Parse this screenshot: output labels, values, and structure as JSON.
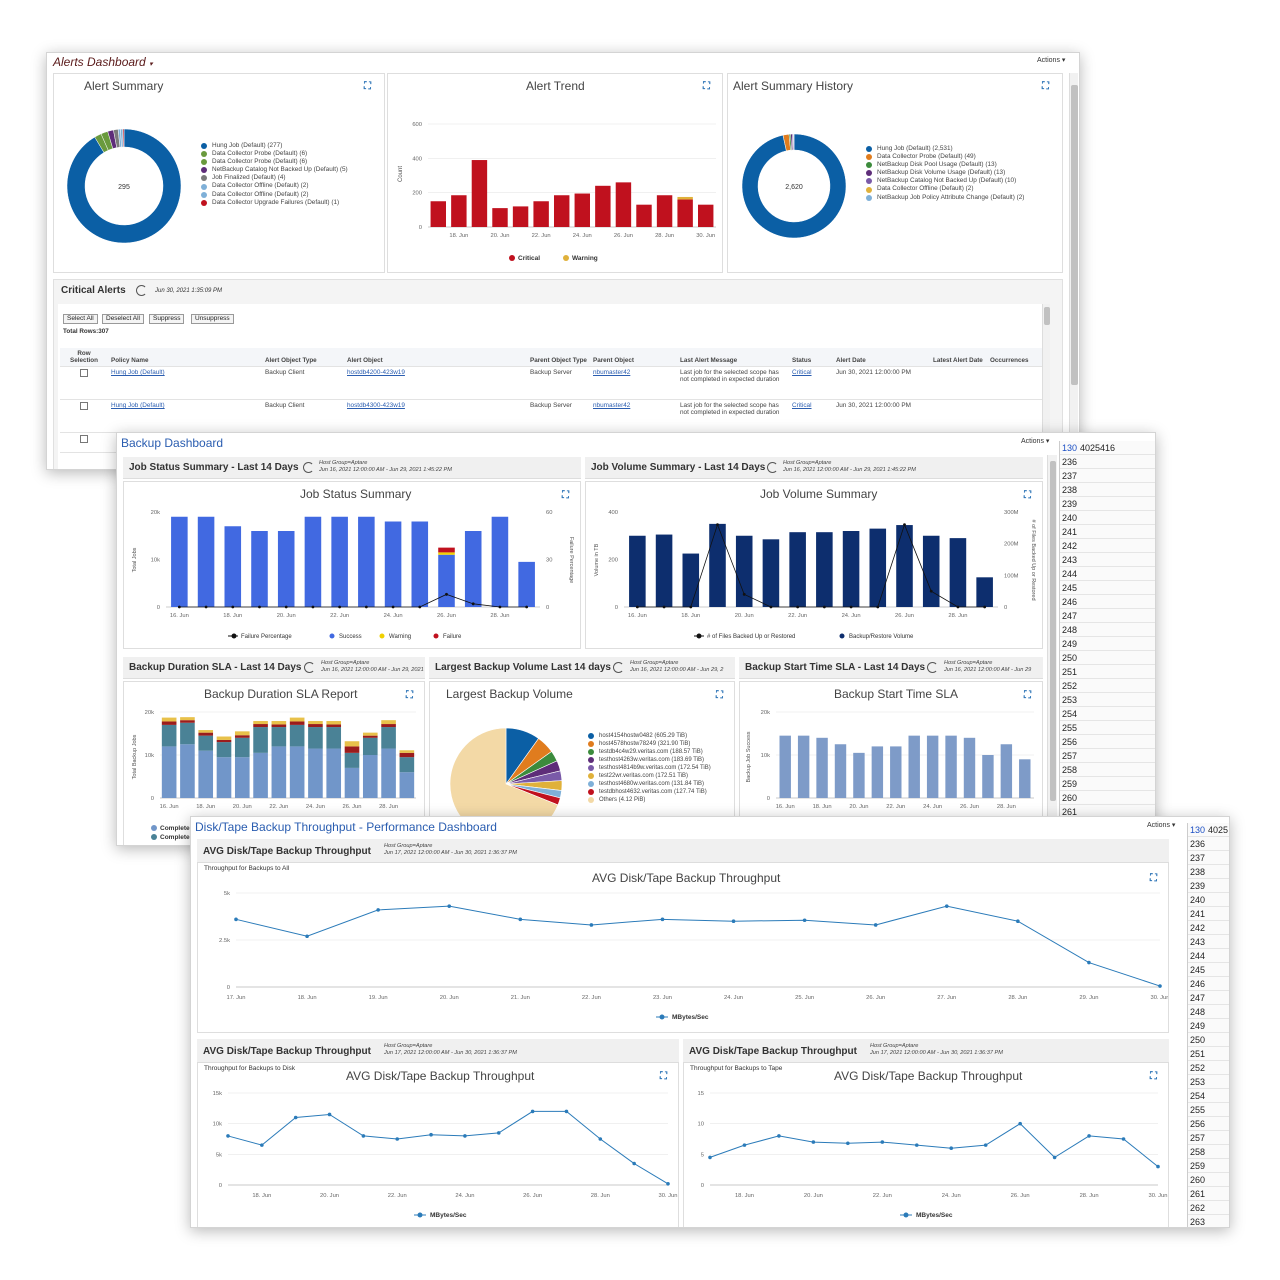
{
  "alerts": {
    "title": "Alerts Dashboard",
    "actions": "Actions",
    "summary": {
      "title": "Alert Summary",
      "center": "295",
      "legend": [
        {
          "label": "Hung Job (Default) (277)",
          "color": "#0b5fa5"
        },
        {
          "label": "Data Collector Probe (Default) (6)",
          "color": "#6a9a3d"
        },
        {
          "label": "Data Collector Probe (Default) (6)",
          "color": "#6a9a3d"
        },
        {
          "label": "NetBackup Catalog Not Backed Up (Default) (5)",
          "color": "#5e2d79"
        },
        {
          "label": "Job Finalized (Default) (4)",
          "color": "#7a7a7a"
        },
        {
          "label": "Data Collector Offline (Default) (2)",
          "color": "#7fb0d8"
        },
        {
          "label": "Data Collector Offline (Default) (2)",
          "color": "#7fb0d8"
        },
        {
          "label": "Data Collector Upgrade Failures (Default) (1)",
          "color": "#c0111e"
        }
      ]
    },
    "trend": {
      "title": "Alert Trend",
      "ylabel": "Count",
      "yticks": [
        "600",
        "400",
        "200",
        "0"
      ],
      "xticks": [
        "18. Jun",
        "20. Jun",
        "22. Jun",
        "24. Jun",
        "26. Jun",
        "28. Jun",
        "30. Jun"
      ],
      "legend": [
        {
          "label": "Critical",
          "color": "#c0111e"
        },
        {
          "label": "Warning",
          "color": "#e0b13a"
        }
      ]
    },
    "history": {
      "title": "Alert Summary History",
      "center": "2,620",
      "legend": [
        {
          "label": "Hung Job (Default) (2,531)",
          "color": "#0b5fa5"
        },
        {
          "label": "Data Collector Probe (Default) (49)",
          "color": "#e07c1e"
        },
        {
          "label": "NetBackup Disk Pool Usage (Default) (13)",
          "color": "#3c8b3c"
        },
        {
          "label": "NetBackup Disk Volume Usage (Default) (13)",
          "color": "#5e2d79"
        },
        {
          "label": "NetBackup Catalog Not Backed Up (Default) (10)",
          "color": "#7a5aa8"
        },
        {
          "label": "Data Collector Offline (Default) (2)",
          "color": "#e0b13a"
        },
        {
          "label": "NetBackup Job Policy Attribute Change (Default) (2)",
          "color": "#7fb0d8"
        }
      ]
    },
    "critical": {
      "title": "Critical Alerts",
      "timestamp": "Jun 30, 2021 1:35:09 PM",
      "buttons": [
        "Select All",
        "Deselect All",
        "Suppress",
        "Unsuppress"
      ],
      "total": "Total Rows:307",
      "columns": [
        "Row Selection",
        "Policy Name",
        "Alert Object Type",
        "Alert Object",
        "Parent Object Type",
        "Parent Object",
        "Last Alert Message",
        "Status",
        "Alert Date",
        "Latest Alert Date",
        "Occurrences"
      ],
      "rows": [
        {
          "policy": "Hung Job (Default)",
          "type": "Backup Client",
          "object": "hostdb4200-423w19",
          "ptype": "Backup Server",
          "parent": "nbumaster42",
          "msg": "Last job for the selected scope has not completed in expected duration",
          "status": "Critical",
          "date": "Jun 30, 2021 12:00:00 PM"
        },
        {
          "policy": "Hung Job (Default)",
          "type": "Backup Client",
          "object": "hostdb4300-423w19",
          "ptype": "Backup Server",
          "parent": "nbumaster42",
          "msg": "Last job for the selected scope has not completed in expected duration",
          "status": "Critical",
          "date": "Jun 30, 2021 12:00:00 PM"
        }
      ]
    }
  },
  "backup": {
    "title": "Backup Dashboard",
    "actions": "Actions",
    "jobstatus": {
      "header": "Job Status Summary - Last 14 Days",
      "meta1": "Host Group=Aptare",
      "meta2": "Jun 16, 2021 12:00:00 AM - Jun 29, 2021 1:45:22 PM",
      "title": "Job Status Summary",
      "ylabel": "Total Jobs",
      "y2label": "Failure Percentage",
      "yticks": [
        "20k",
        "10k",
        "0"
      ],
      "y2ticks": [
        "60",
        "30",
        "0"
      ],
      "xticks": [
        "16. Jun",
        "18. Jun",
        "20. Jun",
        "22. Jun",
        "24. Jun",
        "26. Jun",
        "28. Jun"
      ],
      "legend": [
        {
          "label": "Failure Percentage",
          "color": "#111"
        },
        {
          "label": "Success",
          "color": "#4169e1"
        },
        {
          "label": "Warning",
          "color": "#f0d000"
        },
        {
          "label": "Failure",
          "color": "#c0111e"
        }
      ]
    },
    "jobvolume": {
      "header": "Job Volume Summary - Last 14 Days",
      "meta1": "Host Group=Aptare",
      "meta2": "Jun 16, 2021 12:00:00 AM - Jun 29, 2021 1:45:22 PM",
      "title": "Job Volume Summary",
      "ylabel": "Volume in TB",
      "y2label": "# of Files Backed Up or Restored",
      "yticks": [
        "400",
        "200",
        "0"
      ],
      "y2ticks": [
        "300M",
        "200M",
        "100M",
        "0"
      ],
      "xticks": [
        "16. Jun",
        "18. Jun",
        "20. Jun",
        "22. Jun",
        "24. Jun",
        "26. Jun",
        "28. Jun"
      ],
      "legend": [
        {
          "label": "# of Files Backed Up or Restored",
          "color": "#111"
        },
        {
          "label": "Backup/Restore Volume",
          "color": "#0d2e6e"
        }
      ]
    },
    "duration": {
      "header": "Backup Duration SLA - Last 14 Days",
      "meta1": "Host Group=Aptare",
      "meta2": "Jun 16, 2021 12:00:00 AM - Jun 29, 2021",
      "title": "Backup Duration SLA Report",
      "ylabel": "Total Backup Jobs",
      "yticks": [
        "20k",
        "10k",
        "0"
      ],
      "xticks": [
        "16. Jun",
        "18. Jun",
        "20. Jun",
        "22. Jun",
        "24. Jun",
        "26. Jun",
        "28. Jun"
      ],
      "legend": [
        "Complete",
        "Complete"
      ]
    },
    "largest": {
      "header": "Largest Backup Volume Last 14 days",
      "meta1": "Host Group=Aptare",
      "meta2": "Jun 16, 2021 12:00:00 AM - Jun 29, 2",
      "title": "Largest Backup Volume",
      "legend": [
        {
          "label": "host4154hostw0482 (605.29 TiB)",
          "color": "#0b5fa5"
        },
        {
          "label": "host4578hostw78249 (321.90 TiB)",
          "color": "#e07c1e"
        },
        {
          "label": "testdb4c4w29.veritas.com (188.57 TiB)",
          "color": "#3c8b3c"
        },
        {
          "label": "testhost4263w.veritas.com (183.69 TiB)",
          "color": "#5e2d79"
        },
        {
          "label": "testhost4814b9w.veritas.com (172.54 TiB)",
          "color": "#7a5aa8"
        },
        {
          "label": "test22wr.veritas.com (172.51 TiB)",
          "color": "#e0b13a"
        },
        {
          "label": "testhost4680w.veritas.com (131.84 TiB)",
          "color": "#7fb0d8"
        },
        {
          "label": "testdbhost4632.veritas.com (127.74 TiB)",
          "color": "#c0111e"
        },
        {
          "label": "Others (4.12 PiB)",
          "color": "#f3d9a6"
        }
      ]
    },
    "starttime": {
      "header": "Backup Start Time SLA - Last 14 Days",
      "meta1": "Host Group=Aptare",
      "meta2": "Jun 16, 2021 12:00:00 AM - Jun 29",
      "title": "Backup Start Time SLA",
      "ylabel": "Backup Job Success",
      "yticks": [
        "20k",
        "10k",
        "0"
      ],
      "xticks": [
        "16. Jun",
        "18. Jun",
        "20. Jun",
        "22. Jun",
        "24. Jun",
        "26. Jun",
        "28. Jun"
      ]
    }
  },
  "perf": {
    "title": "Disk/Tape Backup Throughput - Performance Dashboard",
    "actions": "Actions",
    "main": {
      "header": "AVG Disk/Tape Backup Throughput",
      "meta1": "Host Group=Aptare",
      "meta2": "Jun 17, 2021 12:00:00 AM - Jun 30, 2021 1:36:37 PM",
      "subtitle": "Throughput for Backups to All",
      "title": "AVG Disk/Tape Backup Throughput",
      "yticks": [
        "5k",
        "2.5k",
        "0"
      ],
      "xticks": [
        "17. Jun",
        "18. Jun",
        "19. Jun",
        "20. Jun",
        "21. Jun",
        "22. Jun",
        "23. Jun",
        "24. Jun",
        "25. Jun",
        "26. Jun",
        "27. Jun",
        "28. Jun",
        "29. Jun",
        "30. Jun"
      ],
      "legend": "MBytes/Sec"
    },
    "disk": {
      "header": "AVG Disk/Tape Backup Throughput",
      "meta1": "Host Group=Aptare",
      "meta2": "Jun 17, 2021 12:00:00 AM - Jun 30, 2021 1:36:37 PM",
      "subtitle": "Throughput for Backups to Disk",
      "title": "AVG Disk/Tape Backup Throughput",
      "yticks": [
        "15k",
        "10k",
        "5k",
        "0"
      ],
      "xticks": [
        "18. Jun",
        "20. Jun",
        "22. Jun",
        "24. Jun",
        "26. Jun",
        "28. Jun",
        "30. Jun"
      ],
      "legend": "MBytes/Sec"
    },
    "tape": {
      "header": "AVG Disk/Tape Backup Throughput",
      "meta1": "Host Group=Aptare",
      "meta2": "Jun 17, 2021 12:00:00 AM - Jun 30, 2021 1:36:37 PM",
      "subtitle": "Throughput for Backups to Tape",
      "title": "AVG Disk/Tape Backup Throughput",
      "yticks": [
        "15",
        "10",
        "5",
        "0"
      ],
      "xticks": [
        "18. Jun",
        "20. Jun",
        "22. Jun",
        "24. Jun",
        "26. Jun",
        "28. Jun",
        "30. Jun"
      ],
      "legend": "MBytes/Sec"
    }
  },
  "sheet": {
    "cell_ref1": "130",
    "cell_val1": "4025416",
    "cell_ref2": "130",
    "cell_val2": "4025",
    "rows": [
      "236",
      "237",
      "238",
      "239",
      "240",
      "241",
      "242",
      "243",
      "244",
      "245",
      "246",
      "247",
      "248",
      "249",
      "250",
      "251",
      "252",
      "253",
      "254",
      "255",
      "256",
      "257",
      "258",
      "259",
      "260",
      "261",
      "262",
      "263"
    ]
  },
  "chart_data": [
    {
      "type": "pie",
      "title": "Alert Summary",
      "center_label": "295",
      "labels": [
        "Hung Job (Default)",
        "Data Collector Probe (Default)",
        "Data Collector Probe (Default)",
        "NetBackup Catalog Not Backed Up (Default)",
        "Job Finalized (Default)",
        "Data Collector Offline (Default)",
        "Data Collector Offline (Default)",
        "Data Collector Upgrade Failures (Default)"
      ],
      "values": [
        277,
        6,
        6,
        5,
        4,
        2,
        2,
        1
      ]
    },
    {
      "type": "bar",
      "title": "Alert Trend",
      "ylabel": "Count",
      "ylim": [
        0,
        600
      ],
      "categories": [
        "17",
        "18",
        "19",
        "20",
        "21",
        "22",
        "23",
        "24",
        "25",
        "26",
        "27",
        "28",
        "29",
        "30"
      ],
      "series": [
        {
          "name": "Critical",
          "values": [
            150,
            185,
            390,
            110,
            120,
            150,
            185,
            195,
            240,
            260,
            130,
            185,
            160,
            130
          ]
        },
        {
          "name": "Warning",
          "values": [
            0,
            0,
            0,
            0,
            0,
            0,
            0,
            0,
            0,
            0,
            0,
            0,
            15,
            0
          ]
        }
      ]
    },
    {
      "type": "pie",
      "title": "Alert Summary History",
      "center_label": "2,620",
      "labels": [
        "Hung Job (Default)",
        "Data Collector Probe (Default)",
        "NetBackup Disk Pool Usage (Default)",
        "NetBackup Disk Volume Usage (Default)",
        "NetBackup Catalog Not Backed Up (Default)",
        "Data Collector Offline (Default)",
        "NetBackup Job Policy Attribute Change (Default)"
      ],
      "values": [
        2531,
        49,
        13,
        13,
        10,
        2,
        2
      ]
    },
    {
      "type": "bar",
      "title": "Job Status Summary",
      "ylim": [
        0,
        20000
      ],
      "categories": [
        "16",
        "17",
        "18",
        "19",
        "20",
        "21",
        "22",
        "23",
        "24",
        "25",
        "26",
        "27",
        "28",
        "29"
      ],
      "series": [
        {
          "name": "Success",
          "values": [
            19000,
            19000,
            17000,
            16000,
            16000,
            19000,
            19000,
            19000,
            18000,
            18000,
            11000,
            16000,
            19000,
            9500
          ]
        },
        {
          "name": "Warning",
          "values": [
            0,
            0,
            0,
            0,
            0,
            0,
            0,
            0,
            0,
            0,
            500,
            0,
            0,
            0
          ]
        },
        {
          "name": "Failure",
          "values": [
            0,
            0,
            0,
            0,
            0,
            0,
            0,
            0,
            0,
            0,
            1000,
            0,
            0,
            0
          ]
        },
        {
          "name": "Failure Percentage",
          "values": [
            0,
            0,
            0,
            0,
            0,
            0,
            0,
            0,
            0,
            0,
            8,
            2,
            0,
            0
          ]
        }
      ]
    },
    {
      "type": "bar",
      "title": "Job Volume Summary",
      "ylim": [
        0,
        400
      ],
      "categories": [
        "16",
        "17",
        "18",
        "19",
        "20",
        "21",
        "22",
        "23",
        "24",
        "25",
        "26",
        "27",
        "28",
        "29"
      ],
      "series": [
        {
          "name": "Backup/Restore Volume",
          "values": [
            300,
            305,
            225,
            350,
            300,
            285,
            315,
            315,
            320,
            330,
            345,
            300,
            290,
            125
          ]
        },
        {
          "name": "# of Files Backed Up or Restored",
          "values": [
            0,
            0,
            0,
            260,
            40,
            0,
            0,
            0,
            0,
            0,
            260,
            50,
            0,
            0
          ]
        }
      ]
    },
    {
      "type": "pie",
      "title": "Largest Backup Volume",
      "labels": [
        "host4154hostw0482",
        "host4578hostw78249",
        "testdb4c4w29.veritas.com",
        "testhost4263w.veritas.com",
        "testhost4814b9w.veritas.com",
        "test22wr.veritas.com",
        "testhost4680w.veritas.com",
        "testdbhost4632.veritas.com",
        "Others"
      ],
      "values": [
        605.29,
        321.9,
        188.57,
        183.69,
        172.54,
        172.51,
        131.84,
        127.74,
        4219
      ]
    },
    {
      "type": "bar",
      "title": "Backup Start Time SLA",
      "ylim": [
        0,
        20000
      ],
      "categories": [
        "16",
        "17",
        "18",
        "19",
        "20",
        "21",
        "22",
        "23",
        "24",
        "25",
        "26",
        "27",
        "28",
        "29"
      ],
      "values": [
        14500,
        14500,
        14000,
        12500,
        10500,
        12000,
        12000,
        14500,
        14500,
        14500,
        14000,
        10000,
        12500,
        9000
      ]
    },
    {
      "type": "bar",
      "title": "Backup Duration SLA Report",
      "ylim": [
        0,
        20000
      ],
      "categories": [
        "16",
        "17",
        "18",
        "19",
        "20",
        "21",
        "22",
        "23",
        "24",
        "25",
        "26",
        "27",
        "28",
        "29"
      ],
      "series": [
        {
          "name": "Complete",
          "values": [
            12000,
            12500,
            11000,
            9500,
            9500,
            10500,
            12000,
            12000,
            11500,
            11500,
            7000,
            10000,
            11500,
            6000
          ]
        },
        {
          "name": "Complete",
          "values": [
            5000,
            5000,
            3500,
            3500,
            4500,
            6000,
            4500,
            5000,
            5000,
            5000,
            3500,
            4000,
            5000,
            3500
          ]
        }
      ]
    },
    {
      "type": "line",
      "title": "AVG Disk/Tape Backup Throughput",
      "subtitle": "Throughput for Backups to All",
      "ylim": [
        0,
        5000
      ],
      "x": [
        "17. Jun",
        "18. Jun",
        "19. Jun",
        "20. Jun",
        "21. Jun",
        "22. Jun",
        "23. Jun",
        "24. Jun",
        "25. Jun",
        "26. Jun",
        "27. Jun",
        "28. Jun",
        "29. Jun",
        "30. Jun"
      ],
      "series": [
        {
          "name": "MBytes/Sec",
          "values": [
            3600,
            2700,
            4100,
            4300,
            3600,
            3300,
            3600,
            3500,
            3550,
            3300,
            4300,
            3500,
            1300,
            50
          ]
        }
      ]
    },
    {
      "type": "line",
      "title": "AVG Disk/Tape Backup Throughput",
      "subtitle": "Throughput for Backups to Disk",
      "ylim": [
        0,
        15000
      ],
      "x": [
        "17",
        "18",
        "19",
        "20",
        "21",
        "22",
        "23",
        "24",
        "25",
        "26",
        "27",
        "28",
        "29",
        "30"
      ],
      "series": [
        {
          "name": "MBytes/Sec",
          "values": [
            8000,
            6500,
            11000,
            11500,
            8000,
            7500,
            8200,
            8000,
            8500,
            12000,
            12000,
            7500,
            3500,
            200
          ]
        }
      ]
    },
    {
      "type": "line",
      "title": "AVG Disk/Tape Backup Throughput",
      "subtitle": "Throughput for Backups to Tape",
      "ylim": [
        0,
        15
      ],
      "x": [
        "17",
        "18",
        "19",
        "20",
        "21",
        "22",
        "23",
        "24",
        "25",
        "26",
        "27",
        "28",
        "29",
        "30"
      ],
      "series": [
        {
          "name": "MBytes/Sec",
          "values": [
            4.5,
            6.5,
            8,
            7,
            6.8,
            7,
            6.5,
            6,
            6.5,
            10,
            4.5,
            8,
            7.5,
            3
          ]
        }
      ]
    }
  ]
}
